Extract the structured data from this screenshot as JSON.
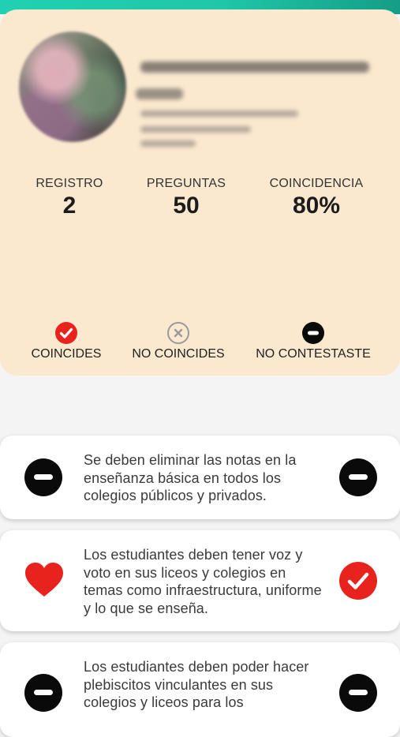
{
  "profile": {
    "stats": [
      {
        "label": "REGISTRO",
        "value": "2"
      },
      {
        "label": "PREGUNTAS",
        "value": "50"
      },
      {
        "label": "COINCIDENCIA",
        "value": "80%"
      }
    ],
    "legend": [
      {
        "label": "COINCIDES",
        "icon": "check-circle-icon",
        "color": "#e8231d"
      },
      {
        "label": "NO COINCIDES",
        "icon": "x-circle-icon",
        "color": "#9a9a9a"
      },
      {
        "label": "NO CONTESTASTE",
        "icon": "minus-circle-icon",
        "color": "#0a0a0a"
      }
    ]
  },
  "questions": [
    {
      "text": "Se deben eliminar las notas en la enseñanza básica en todos los colegios públicos y privados.",
      "left_icon": "minus-circle-icon",
      "right_icon": "minus-circle-icon"
    },
    {
      "text": "Los estudiantes deben tener voz y voto en sus liceos y colegios en temas como infraestructura, uniforme y lo que se enseña.",
      "left_icon": "heart-icon",
      "right_icon": "check-circle-icon"
    },
    {
      "text": "Los estudiantes deben poder hacer plebiscitos vinculantes en sus colegios y liceos para los",
      "left_icon": "minus-circle-icon",
      "right_icon": "minus-circle-icon"
    }
  ],
  "colors": {
    "accent_bar": "#1fd1b2",
    "card_bg": "#fbe9cf",
    "match_red": "#e8231d"
  }
}
